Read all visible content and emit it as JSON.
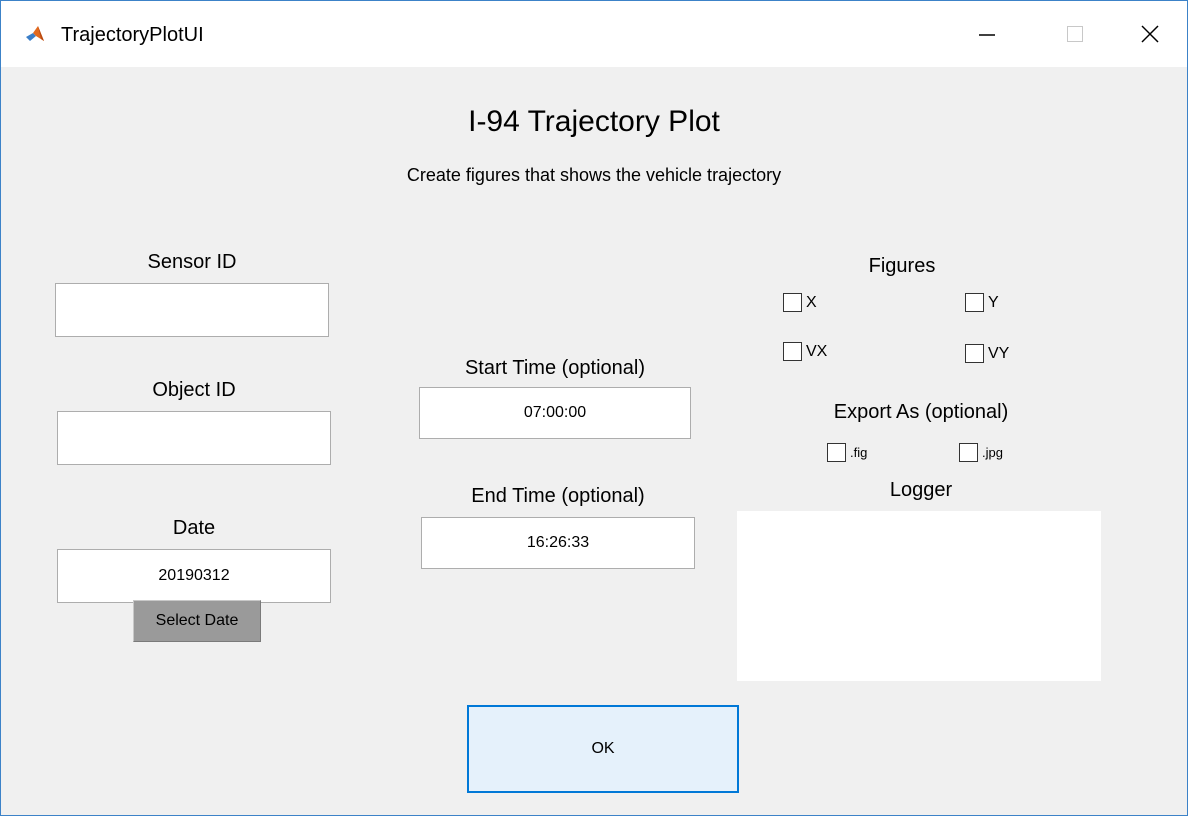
{
  "window": {
    "title": "TrajectoryPlotUI",
    "accent_color": "#0078d7",
    "controls": {
      "minimize_icon": "minimize-icon",
      "maximize_icon": "maximize-icon",
      "close_icon": "close-icon"
    }
  },
  "header": {
    "title": "I-94 Trajectory Plot",
    "subtitle": "Create figures that shows the vehicle trajectory"
  },
  "left": {
    "sensor_id": {
      "label": "Sensor ID",
      "value": ""
    },
    "object_id": {
      "label": "Object ID",
      "value": ""
    },
    "date": {
      "label": "Date",
      "value": "20190312",
      "button_label": "Select Date"
    }
  },
  "middle": {
    "start_time": {
      "label": "Start Time (optional)",
      "value": "07:00:00"
    },
    "end_time": {
      "label": "End Time (optional)",
      "value": "16:26:33"
    }
  },
  "figures": {
    "label": "Figures",
    "options": [
      {
        "label": "X",
        "checked": false
      },
      {
        "label": "Y",
        "checked": false
      },
      {
        "label": "VX",
        "checked": false
      },
      {
        "label": "VY",
        "checked": false
      }
    ]
  },
  "export": {
    "label": "Export As (optional)",
    "options": [
      {
        "label": ".fig",
        "checked": false
      },
      {
        "label": ".jpg",
        "checked": false
      }
    ]
  },
  "logger": {
    "label": "Logger",
    "content": ""
  },
  "ok_button": {
    "label": "OK"
  }
}
